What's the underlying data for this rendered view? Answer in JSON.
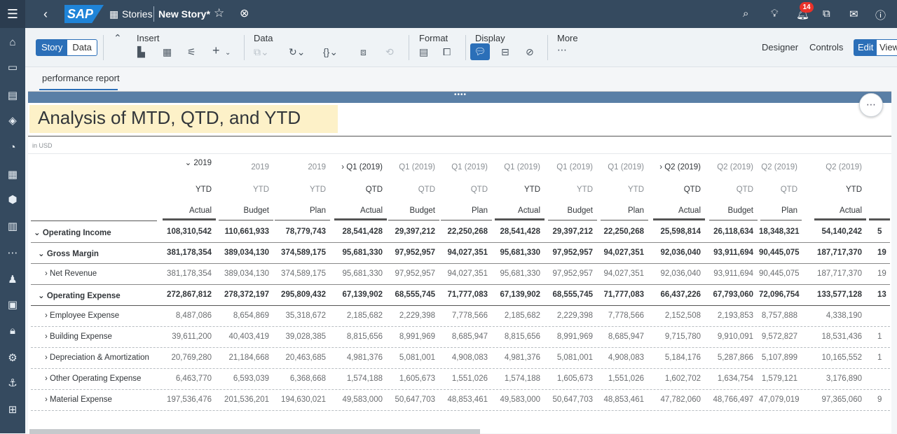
{
  "topbar": {
    "logo": "SAP",
    "stories": "Stories",
    "story_name": "New Story",
    "modified_mark": "*",
    "notification_count": "14"
  },
  "toolbar": {
    "story_tab": "Story",
    "data_tab": "Data",
    "insert_label": "Insert",
    "data_label": "Data",
    "format_label": "Format",
    "display_label": "Display",
    "more_label": "More",
    "designer_label": "Designer",
    "controls_label": "Controls",
    "edit_label": "Edit",
    "view_label": "View"
  },
  "page_tab": "performance report",
  "widget": {
    "title": "Analysis of MTD, QTD, and YTD",
    "unit_note": "in USD"
  },
  "table": {
    "col_period": [
      "2019",
      "2019",
      "2019",
      "Q1 (2019)",
      "Q1 (2019)",
      "Q1 (2019)",
      "Q1 (2019)",
      "Q1 (2019)",
      "Q1 (2019)",
      "Q2 (2019)",
      "Q2 (2019)",
      "Q2 (2019)",
      "Q2 (2019)"
    ],
    "col_measure": [
      "YTD",
      "YTD",
      "YTD",
      "QTD",
      "QTD",
      "QTD",
      "YTD",
      "YTD",
      "YTD",
      "QTD",
      "QTD",
      "QTD",
      "YTD"
    ],
    "col_version": [
      "Actual",
      "Budget",
      "Plan",
      "Actual",
      "Budget",
      "Plan",
      "Actual",
      "Budget",
      "Plan",
      "Actual",
      "Budget",
      "Plan",
      "Actual"
    ],
    "rows": [
      {
        "label": "Operating Income",
        "values": [
          "108,310,542",
          "110,661,933",
          "78,779,743",
          "28,541,428",
          "29,397,212",
          "22,250,268",
          "28,541,428",
          "29,397,212",
          "22,250,268",
          "25,598,814",
          "26,118,634",
          "18,348,321",
          "54,140,242"
        ],
        "extra": "5"
      },
      {
        "label": "Gross Margin",
        "values": [
          "381,178,354",
          "389,034,130",
          "374,589,175",
          "95,681,330",
          "97,952,957",
          "94,027,351",
          "95,681,330",
          "97,952,957",
          "94,027,351",
          "92,036,040",
          "93,911,694",
          "90,445,075",
          "187,717,370"
        ],
        "extra": "19"
      },
      {
        "label": "Net Revenue",
        "values": [
          "381,178,354",
          "389,034,130",
          "374,589,175",
          "95,681,330",
          "97,952,957",
          "94,027,351",
          "95,681,330",
          "97,952,957",
          "94,027,351",
          "92,036,040",
          "93,911,694",
          "90,445,075",
          "187,717,370"
        ],
        "extra": "19"
      },
      {
        "label": "Operating Expense",
        "values": [
          "272,867,812",
          "278,372,197",
          "295,809,432",
          "67,139,902",
          "68,555,745",
          "71,777,083",
          "67,139,902",
          "68,555,745",
          "71,777,083",
          "66,437,226",
          "67,793,060",
          "72,096,754",
          "133,577,128"
        ],
        "extra": "13"
      },
      {
        "label": "Employee Expense",
        "values": [
          "8,487,086",
          "8,654,869",
          "35,318,672",
          "2,185,682",
          "2,229,398",
          "7,778,566",
          "2,185,682",
          "2,229,398",
          "7,778,566",
          "2,152,508",
          "2,193,853",
          "8,757,888",
          "4,338,190"
        ],
        "extra": ""
      },
      {
        "label": "Building Expense",
        "values": [
          "39,611,200",
          "40,403,419",
          "39,028,385",
          "8,815,656",
          "8,991,969",
          "8,685,947",
          "8,815,656",
          "8,991,969",
          "8,685,947",
          "9,715,780",
          "9,910,091",
          "9,572,827",
          "18,531,436"
        ],
        "extra": "1"
      },
      {
        "label": "Depreciation & Amortization",
        "values": [
          "20,769,280",
          "21,184,668",
          "20,463,685",
          "4,981,376",
          "5,081,001",
          "4,908,083",
          "4,981,376",
          "5,081,001",
          "4,908,083",
          "5,184,176",
          "5,287,866",
          "5,107,899",
          "10,165,552"
        ],
        "extra": "1"
      },
      {
        "label": "Other Operating Expense",
        "values": [
          "6,463,770",
          "6,593,039",
          "6,368,668",
          "1,574,188",
          "1,605,673",
          "1,551,026",
          "1,574,188",
          "1,605,673",
          "1,551,026",
          "1,602,702",
          "1,634,754",
          "1,579,121",
          "3,176,890"
        ],
        "extra": ""
      },
      {
        "label": "Material Expense",
        "values": [
          "197,536,476",
          "201,536,201",
          "194,630,021",
          "49,583,000",
          "50,647,703",
          "48,853,461",
          "49,583,000",
          "50,647,703",
          "48,853,461",
          "47,782,060",
          "48,766,497",
          "47,079,019",
          "97,365,060"
        ],
        "extra": "9"
      }
    ]
  },
  "colors": {
    "shell": "#354a5f",
    "accent": "#2b6fb8",
    "title_bg": "#fdf1c8"
  }
}
